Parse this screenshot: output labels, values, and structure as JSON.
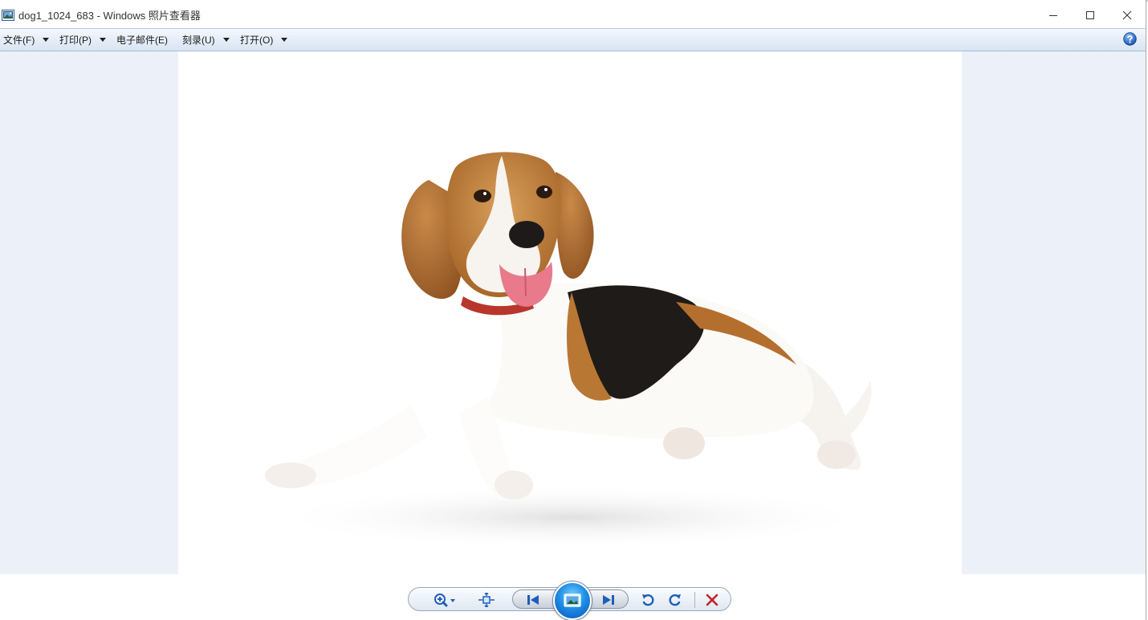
{
  "window": {
    "title": "dog1_1024_683 - Windows 照片查看器",
    "controls": {
      "minimize_icon": "minimize-icon",
      "maximize_icon": "maximize-icon",
      "close_icon": "close-icon"
    }
  },
  "menu": {
    "items": [
      {
        "label": "文件(F)",
        "has_dropdown": true
      },
      {
        "label": "打印(P)",
        "has_dropdown": true
      },
      {
        "label": "电子邮件(E)",
        "has_dropdown": false
      },
      {
        "label": "刻录(U)",
        "has_dropdown": true
      },
      {
        "label": "打开(O)",
        "has_dropdown": true
      }
    ],
    "help_icon": "help-icon"
  },
  "photo": {
    "subject": "beagle-dog-photo"
  },
  "toolbar": {
    "buttons": [
      {
        "id": "zoom",
        "icon": "zoom-icon"
      },
      {
        "id": "actual-size",
        "icon": "fit-window-icon"
      },
      {
        "id": "previous",
        "icon": "previous-icon"
      },
      {
        "id": "slideshow",
        "icon": "slideshow-icon"
      },
      {
        "id": "next",
        "icon": "next-icon"
      },
      {
        "id": "rotate-ccw",
        "icon": "rotate-counterclockwise-icon"
      },
      {
        "id": "rotate-cw",
        "icon": "rotate-clockwise-icon"
      },
      {
        "id": "delete",
        "icon": "delete-icon"
      }
    ]
  },
  "colors": {
    "viewer_background": "#ecf1f9",
    "menubar_gradient_top": "#f4f8fd",
    "menubar_gradient_bottom": "#d9e5f3",
    "delete_red": "#c0262b",
    "toolbar_blue": "#1e5eb8"
  }
}
